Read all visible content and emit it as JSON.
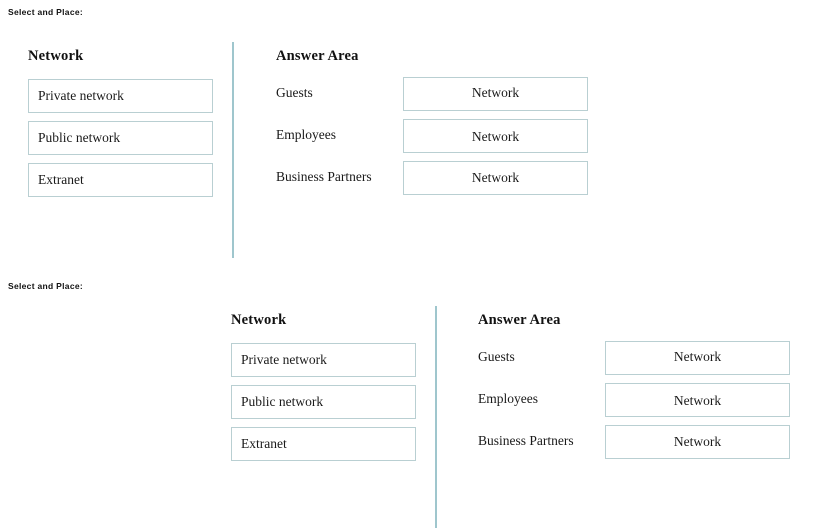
{
  "colors": {
    "divider": "#9fc6cd",
    "box_border": "#b9cfd2",
    "text": "#1a1a1a",
    "background": "#ffffff"
  },
  "sections": [
    {
      "caption": "Select and Place:",
      "source": {
        "title": "Network",
        "items": [
          {
            "label": "Private network"
          },
          {
            "label": "Public network"
          },
          {
            "label": "Extranet"
          }
        ]
      },
      "answer": {
        "title": "Answer Area",
        "rows": [
          {
            "label": "Guests",
            "value": "Network"
          },
          {
            "label": "Employees",
            "value": "Network"
          },
          {
            "label": "Business Partners",
            "value": "Network"
          }
        ]
      }
    },
    {
      "caption": "Select and Place:",
      "source": {
        "title": "Network",
        "items": [
          {
            "label": "Private network"
          },
          {
            "label": "Public network"
          },
          {
            "label": "Extranet"
          }
        ]
      },
      "answer": {
        "title": "Answer Area",
        "rows": [
          {
            "label": "Guests",
            "value": "Network"
          },
          {
            "label": "Employees",
            "value": "Network"
          },
          {
            "label": "Business Partners",
            "value": "Network"
          }
        ]
      }
    }
  ]
}
